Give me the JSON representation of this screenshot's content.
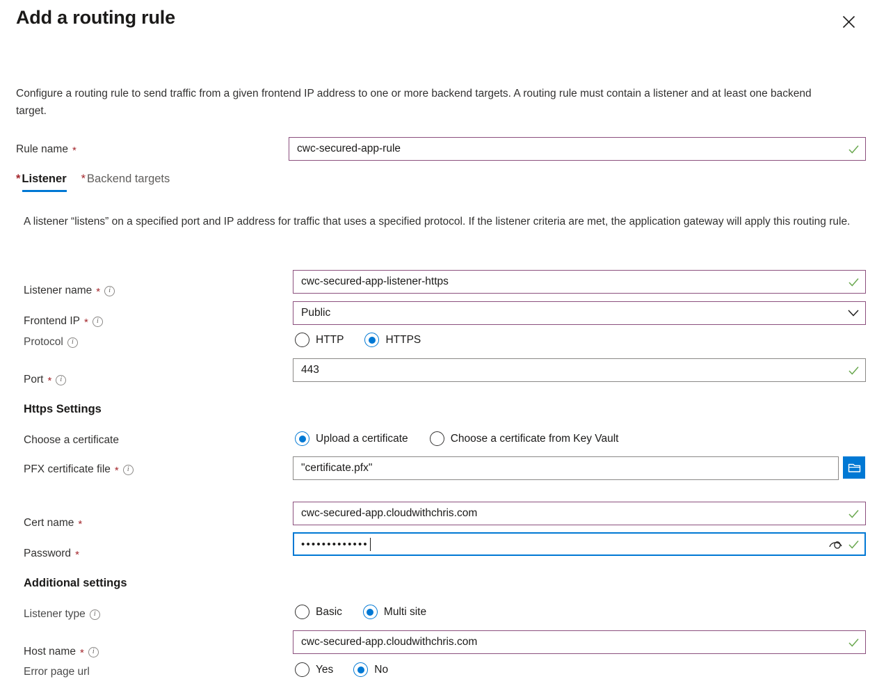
{
  "panel": {
    "title": "Add a routing rule",
    "close_icon": "close-icon",
    "description": "Configure a routing rule to send traffic from a given frontend IP address to one or more backend targets. A routing rule must contain a listener and at least one backend target."
  },
  "rule_name": {
    "label": "Rule name",
    "required": "*",
    "value": "cwc-secured-app-rule",
    "state": "valid"
  },
  "tabs": [
    {
      "label": "Listener",
      "star": "*",
      "active": true
    },
    {
      "label": "Backend targets",
      "star": "*",
      "active": false
    }
  ],
  "listener": {
    "description": "A listener “listens” on a specified port and IP address for traffic that uses a specified protocol. If the listener criteria are met, the application gateway will apply this routing rule.",
    "listener_name": {
      "label": "Listener name",
      "required": "*",
      "value": "cwc-secured-app-listener-https"
    },
    "frontend_ip": {
      "label": "Frontend IP",
      "required": "*",
      "value": "Public"
    },
    "protocol": {
      "label": "Protocol",
      "options": [
        "HTTP",
        "HTTPS"
      ],
      "selected": "HTTPS"
    },
    "port": {
      "label": "Port",
      "required": "*",
      "value": "443"
    }
  },
  "https_settings": {
    "heading": "Https Settings",
    "choose_certificate": {
      "label": "Choose a certificate",
      "options": [
        "Upload a certificate",
        "Choose a certificate from Key Vault"
      ],
      "selected": "Upload a certificate"
    },
    "pfx_file": {
      "label": "PFX certificate file",
      "required": "*",
      "value": "\"certificate.pfx\"",
      "browse_icon": "folder-icon"
    },
    "cert_name": {
      "label": "Cert name",
      "required": "*",
      "value": "cwc-secured-app.cloudwithchris.com"
    },
    "password": {
      "label": "Password",
      "required": "*",
      "value": "•••••••••••••",
      "reveal_icon": "eye-icon",
      "focused": true
    }
  },
  "additional_settings": {
    "heading": "Additional settings",
    "listener_type": {
      "label": "Listener type",
      "options": [
        "Basic",
        "Multi site"
      ],
      "selected": "Multi site"
    },
    "host_name": {
      "label": "Host name",
      "required": "*",
      "value": "cwc-secured-app.cloudwithchris.com"
    },
    "error_page_url": {
      "label": "Error page url",
      "options": [
        "Yes",
        "No"
      ],
      "selected": "No"
    }
  },
  "colors": {
    "accent": "#0078d4",
    "valid_border": "#8b4f7d",
    "required_star": "#a4262c",
    "check": "#6aa84f"
  }
}
